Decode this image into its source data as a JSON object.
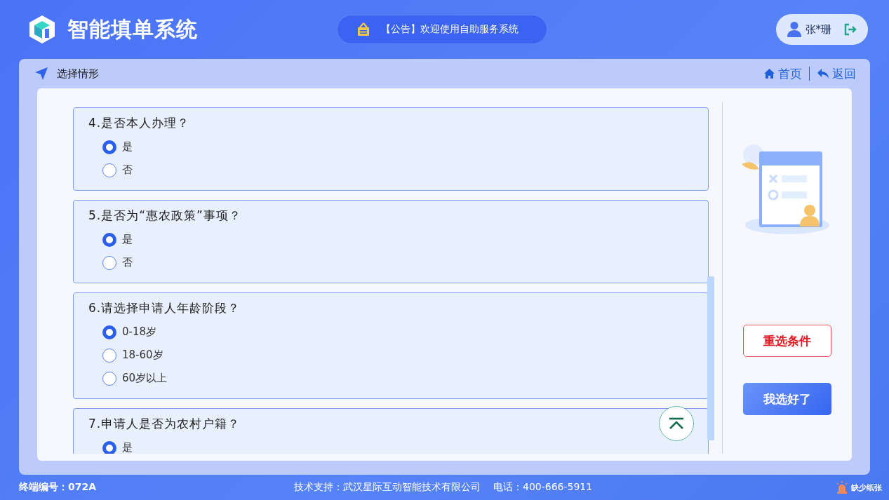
{
  "header": {
    "title": "智能填单系统",
    "notice": "【公告】欢迎使用自助服务系统",
    "user": "张*珊"
  },
  "panel": {
    "title": "选择情形",
    "nav": [
      {
        "kind": "home",
        "label": "首页"
      },
      {
        "kind": "back",
        "label": "返回"
      }
    ]
  },
  "questions": [
    {
      "title": "4.是否本人办理？",
      "options": [
        {
          "label": "是",
          "selected": true
        },
        {
          "label": "否",
          "selected": false
        }
      ]
    },
    {
      "title": "5.是否为“惠农政策”事项？",
      "options": [
        {
          "label": "是",
          "selected": true
        },
        {
          "label": "否",
          "selected": false
        }
      ]
    },
    {
      "title": "6.请选择申请人年龄阶段？",
      "options": [
        {
          "label": "0-18岁",
          "selected": true
        },
        {
          "label": "18-60岁",
          "selected": false
        },
        {
          "label": "60岁以上",
          "selected": false
        }
      ]
    },
    {
      "title": "7.申请人是否为农村户籍？",
      "options": [
        {
          "label": "是",
          "selected": true
        }
      ]
    }
  ],
  "buttons": [
    {
      "kind": "reset",
      "label": "重选条件"
    },
    {
      "kind": "confirm",
      "label": "我选好了"
    }
  ],
  "footer": {
    "terminal": "终端编号：072A",
    "support": "技术支持：武汉星际互动智能技术有限公司",
    "phone": "电话：400-666-5911",
    "alert": "缺少纸张"
  }
}
